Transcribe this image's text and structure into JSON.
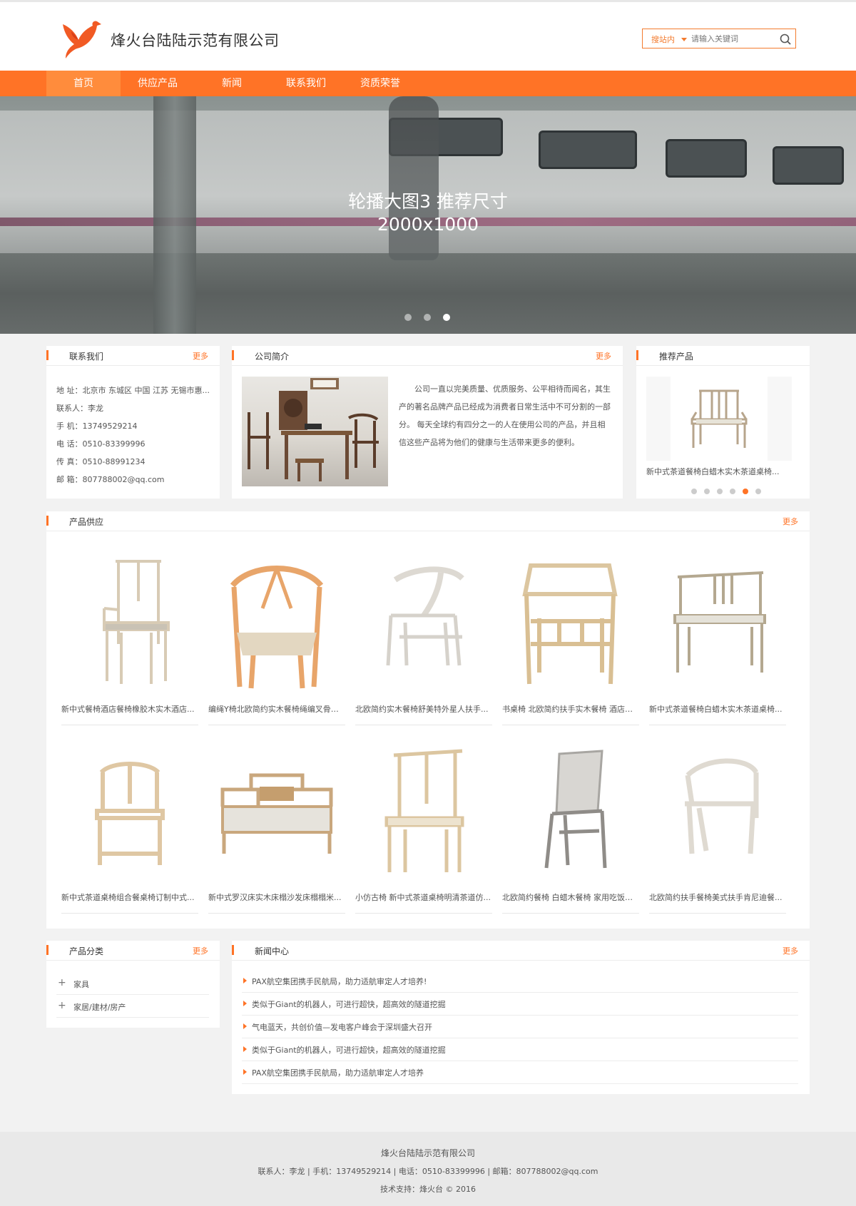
{
  "header": {
    "site_name": "烽火台陆陆示范有限公司",
    "search": {
      "scope": "搜站内",
      "placeholder": "请输入关键词"
    }
  },
  "nav": {
    "items": [
      {
        "label": "首页",
        "active": true
      },
      {
        "label": "供应产品"
      },
      {
        "label": "新闻"
      },
      {
        "label": "联系我们"
      },
      {
        "label": "资质荣誉"
      }
    ]
  },
  "banner": {
    "caption_line1": "轮播大图3  推荐尺寸",
    "caption_line2": "2000x1000",
    "slide_count": 3,
    "active_slide": 3
  },
  "contact": {
    "title": "联系我们",
    "more": "更多",
    "lines": [
      "地 址：北京市 东城区 中国 江苏 无锡市惠...",
      "联系人：李龙",
      "手 机：13749529214",
      "电 话：0510-83399996",
      "传 真：0510-88991234",
      "邮 箱：807788002@qq.com"
    ]
  },
  "intro": {
    "title": "公司简介",
    "more": "更多",
    "text": "公司一直以完美质量、优质服务、公平相待而闻名，其生产的著名品牌产品已经成为消费者日常生活中不可分割的一部分。 每天全球约有四分之一的人在使用公司的产品，并且相信这些产品将为他们的健康与生活带来更多的便利。"
  },
  "recommended": {
    "title": "推荐产品",
    "name": "新中式茶道餐椅白蜡木实木茶道桌椅...",
    "dot_count": 6,
    "active_dot": 5
  },
  "products": {
    "title": "产品供应",
    "more": "更多",
    "items": [
      {
        "name": "新中式餐椅酒店餐椅橡胶木实木酒店..."
      },
      {
        "name": "编绳Y椅北欧简约实木餐椅绳编叉骨汉..."
      },
      {
        "name": "北欧简约实木餐椅舒美特外星人扶手..."
      },
      {
        "name": "书桌椅 北欧简约扶手实木餐椅 酒店椅 ..."
      },
      {
        "name": "新中式茶道餐椅白蜡木实木茶道桌椅..."
      },
      {
        "name": "新中式茶道桌椅组合餐桌椅订制中式..."
      },
      {
        "name": "新中式罗汉床实木床榻沙发床榻榻米..."
      },
      {
        "name": "小仿古椅 新中式茶道桌椅明清茶道仿..."
      },
      {
        "name": "北欧简约餐椅 白蜡木餐椅 家用吃饭实..."
      },
      {
        "name": "北欧简约扶手餐椅美式扶手肯尼迪餐..."
      }
    ]
  },
  "categories": {
    "title": "产品分类",
    "more": "更多",
    "items": [
      {
        "label": "家具"
      },
      {
        "label": "家居/建材/房产"
      }
    ]
  },
  "news": {
    "title": "新闻中心",
    "more": "更多",
    "items": [
      {
        "label": "PAX航空集团携手民航局，助力适航审定人才培养!"
      },
      {
        "label": "类似于Giant的机器人，可进行超快，超高效的隧道挖掘"
      },
      {
        "label": "气电蓝天，共创价值—发电客户峰会于深圳盛大召开"
      },
      {
        "label": "类似于Giant的机器人，可进行超快，超高效的隧道挖掘"
      },
      {
        "label": "PAX航空集团携手民航局，助力适航审定人才培养"
      }
    ]
  },
  "footer": {
    "company": "烽火台陆陆示范有限公司",
    "contacts": "联系人：李龙    |    手机：13749529214    |    电话：0510-83399996    |    邮箱：807788002@qq.com",
    "support": "技术支持：烽火台 © 2016"
  },
  "colors": {
    "accent": "#ff7326",
    "background": "#f2f2f2"
  }
}
